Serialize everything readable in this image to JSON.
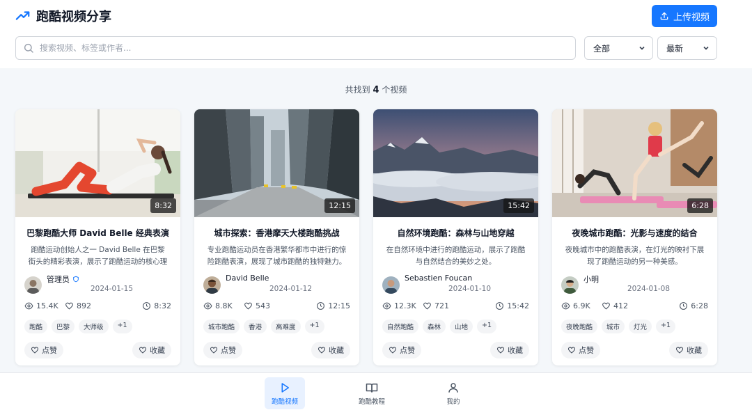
{
  "header": {
    "title": "跑酷视频分享",
    "upload_label": "上传视频"
  },
  "search": {
    "placeholder": "搜索视频、标签或作者...",
    "value": ""
  },
  "filters": {
    "category": "全部",
    "sort": "最新"
  },
  "result": {
    "prefix": "共找到",
    "count": "4",
    "suffix": "个视频"
  },
  "videos": [
    {
      "duration": "8:32",
      "title": "巴黎跑酷大师 David Belle 经典表演",
      "desc": "跑酷运动创始人之一 David Belle 在巴黎街头的精彩表演，展示了跑酷运动的核心理念...",
      "author": "管理员",
      "date": "2024-01-15",
      "views": "15.4K",
      "likes": "892",
      "tags": [
        "跑酷",
        "巴黎",
        "大师级",
        "+1"
      ],
      "like_label": "点赞",
      "fav_label": "收藏"
    },
    {
      "duration": "12:15",
      "title": "城市探索：香港摩天大楼跑酷挑战",
      "desc": "专业跑酷运动员在香港繁华都市中进行的惊险跑酷表演，展现了城市跑酷的独特魅力。",
      "author": "David Belle",
      "date": "2024-01-12",
      "views": "8.8K",
      "likes": "543",
      "tags": [
        "城市跑酷",
        "香港",
        "高难度",
        "+1"
      ],
      "like_label": "点赞",
      "fav_label": "收藏"
    },
    {
      "duration": "15:42",
      "title": "自然环境跑酷：森林与山地穿越",
      "desc": "在自然环境中进行的跑酷运动，展示了跑酷与自然结合的美妙之处。",
      "author": "Sebastien Foucan",
      "date": "2024-01-10",
      "views": "12.3K",
      "likes": "721",
      "tags": [
        "自然跑酷",
        "森林",
        "山地",
        "+1"
      ],
      "like_label": "点赞",
      "fav_label": "收藏"
    },
    {
      "duration": "6:28",
      "title": "夜晚城市跑酷：光影与速度的结合",
      "desc": "夜晚城市中的跑酷表演，在灯光的映衬下展现了跑酷运动的另一种美感。",
      "author": "小明",
      "date": "2024-01-08",
      "views": "6.9K",
      "likes": "412",
      "tags": [
        "夜晚跑酷",
        "城市",
        "灯光",
        "+1"
      ],
      "like_label": "点赞",
      "fav_label": "收藏"
    }
  ],
  "nav": [
    {
      "label": "跑酷视频",
      "icon": "play-icon",
      "active": true
    },
    {
      "label": "跑酷教程",
      "icon": "book-icon",
      "active": false
    },
    {
      "label": "我的",
      "icon": "user-icon",
      "active": false
    }
  ],
  "colors": {
    "accent": "#1677ff",
    "background": "#f4f7fa"
  }
}
